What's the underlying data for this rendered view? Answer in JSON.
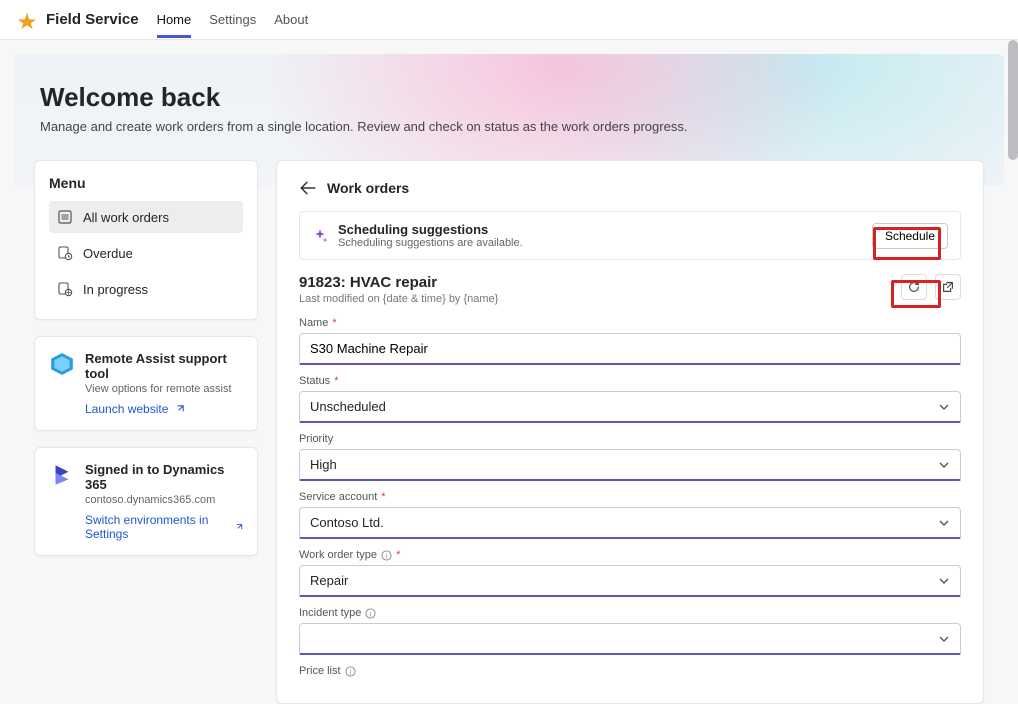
{
  "app": {
    "title": "Field Service",
    "navTabs": [
      {
        "label": "Home",
        "active": true
      },
      {
        "label": "Settings",
        "active": false
      },
      {
        "label": "About",
        "active": false
      }
    ]
  },
  "hero": {
    "title": "Welcome back",
    "subtitle": "Manage and create work orders from a single location. Review and check on status as the work orders progress."
  },
  "sidebar": {
    "title": "Menu",
    "items": [
      {
        "label": "All work orders",
        "selected": true
      },
      {
        "label": "Overdue",
        "selected": false
      },
      {
        "label": "In progress",
        "selected": false
      }
    ],
    "remoteAssist": {
      "title": "Remote Assist support tool",
      "subtitle": "View options for remote assist",
      "linkLabel": "Launch website"
    },
    "signedIn": {
      "title": "Signed in to Dynamics 365",
      "subtitle": "contoso.dynamics365.com",
      "linkLabel": "Switch environments in Settings"
    }
  },
  "workOrders": {
    "pageTitle": "Work orders",
    "suggestion": {
      "title": "Scheduling suggestions",
      "subtitle": "Scheduling suggestions are available.",
      "buttonLabel": "Schedule"
    },
    "order": {
      "title": "91823: HVAC repair",
      "meta": "Last modified on {date & time} by {name}"
    },
    "fields": {
      "nameLabel": "Name",
      "nameValue": "S30 Machine Repair",
      "statusLabel": "Status",
      "statusValue": "Unscheduled",
      "priorityLabel": "Priority",
      "priorityValue": "High",
      "serviceAccountLabel": "Service account",
      "serviceAccountValue": "Contoso Ltd.",
      "workOrderTypeLabel": "Work order type",
      "workOrderTypeValue": "Repair",
      "incidentTypeLabel": "Incident type",
      "incidentTypeValue": "",
      "priceListLabel": "Price list"
    }
  }
}
